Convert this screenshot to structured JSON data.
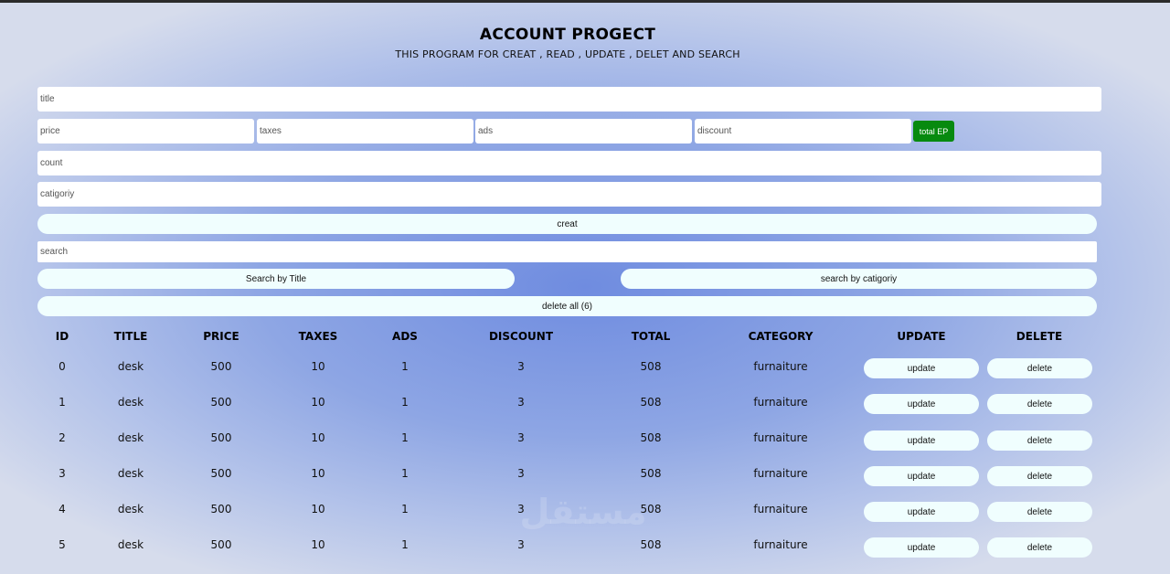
{
  "header": {
    "title": "ACCOUNT PROGECT",
    "subtitle": "THIS PROGRAM FOR CREAT , READ , UPDATE , DELET AND SEARCH"
  },
  "form": {
    "title_placeholder": "title",
    "price_placeholder": "price",
    "taxes_placeholder": "taxes",
    "ads_placeholder": "ads",
    "discount_placeholder": "discount",
    "total_label": "total EP",
    "count_placeholder": "count",
    "category_placeholder": "catigoriy",
    "create_label": "creat",
    "search_placeholder": "search",
    "search_title_label": "Search by Title",
    "search_category_label": "search by catigoriy",
    "delete_all_label": "delete all (6)"
  },
  "colors": {
    "total_button": "#078a0f",
    "pill_background": "#f0fefe"
  },
  "table": {
    "headers": [
      "ID",
      "TITLE",
      "PRICE",
      "TAXES",
      "ADS",
      "DISCOUNT",
      "TOTAL",
      "CATEGORY",
      "UPDATE",
      "DELETE"
    ],
    "rows": [
      {
        "id": "0",
        "title": "desk",
        "price": "500",
        "taxes": "10",
        "ads": "1",
        "discount": "3",
        "total": "508",
        "category": "furnaiture",
        "update": "update",
        "delete": "delete"
      },
      {
        "id": "1",
        "title": "desk",
        "price": "500",
        "taxes": "10",
        "ads": "1",
        "discount": "3",
        "total": "508",
        "category": "furnaiture",
        "update": "update",
        "delete": "delete"
      },
      {
        "id": "2",
        "title": "desk",
        "price": "500",
        "taxes": "10",
        "ads": "1",
        "discount": "3",
        "total": "508",
        "category": "furnaiture",
        "update": "update",
        "delete": "delete"
      },
      {
        "id": "3",
        "title": "desk",
        "price": "500",
        "taxes": "10",
        "ads": "1",
        "discount": "3",
        "total": "508",
        "category": "furnaiture",
        "update": "update",
        "delete": "delete"
      },
      {
        "id": "4",
        "title": "desk",
        "price": "500",
        "taxes": "10",
        "ads": "1",
        "discount": "3",
        "total": "508",
        "category": "furnaiture",
        "update": "update",
        "delete": "delete"
      },
      {
        "id": "5",
        "title": "desk",
        "price": "500",
        "taxes": "10",
        "ads": "1",
        "discount": "3",
        "total": "508",
        "category": "furnaiture",
        "update": "update",
        "delete": "delete"
      }
    ]
  },
  "watermark": "مستقل"
}
